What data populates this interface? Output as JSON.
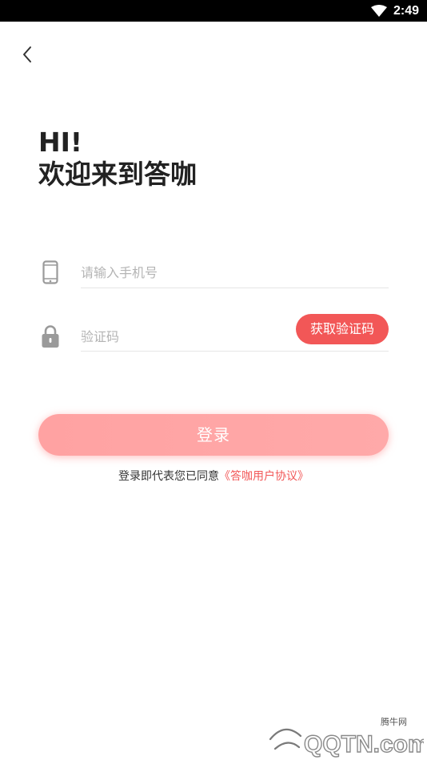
{
  "status_bar": {
    "time": "2:49",
    "icons": [
      "wifi-icon"
    ]
  },
  "header": {
    "back_icon": "chevron-left-icon"
  },
  "greeting": {
    "line1": "HI!",
    "line2": "欢迎来到答咖"
  },
  "form": {
    "phone": {
      "icon": "mobile-phone-icon",
      "placeholder": "请输入手机号",
      "value": ""
    },
    "code": {
      "icon": "lock-icon",
      "placeholder": "验证码",
      "value": "",
      "get_code_label": "获取验证码"
    },
    "login_label": "登录"
  },
  "agreement": {
    "prefix": "登录即代表您已同意",
    "link": "《答咖用户协议》"
  },
  "watermark": {
    "cn_text": "腾牛网",
    "logo_text": "QQTN.com"
  },
  "colors": {
    "accent": "#f25757",
    "login_button": "#ffa6a6",
    "placeholder": "#b4b4b4",
    "status_bar": "#000000"
  }
}
